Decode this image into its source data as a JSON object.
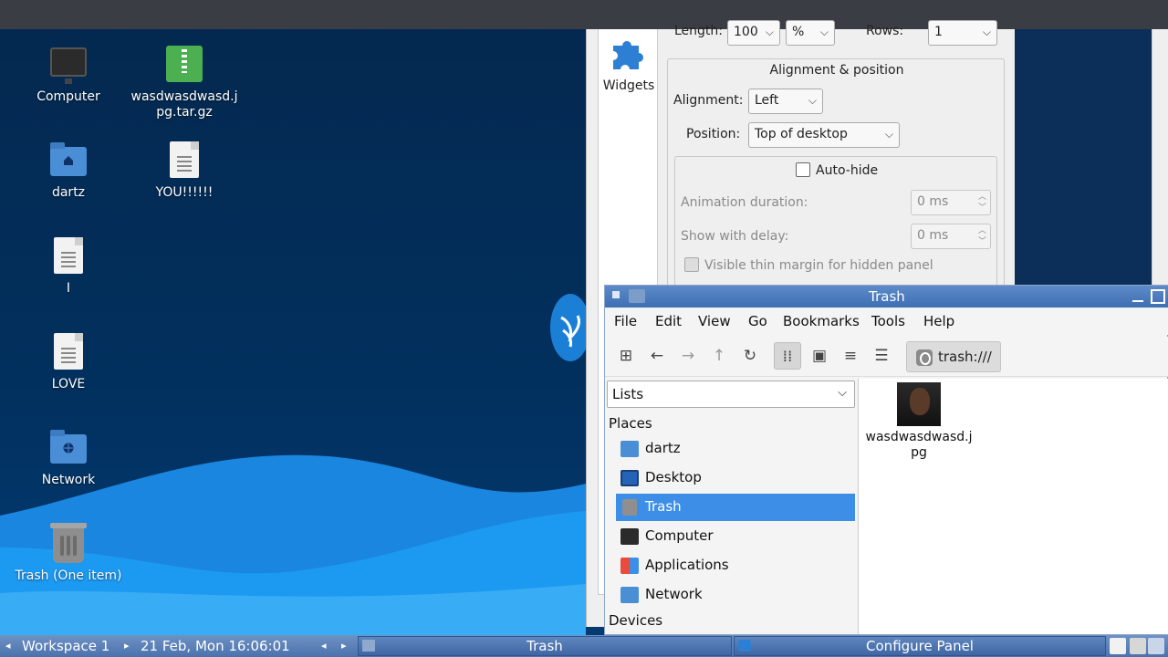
{
  "desktop": {
    "icons": [
      {
        "label": "Computer",
        "icon": "computer-icon"
      },
      {
        "label": "wasdwasdwasd.jpg.tar.gz",
        "icon": "archive-icon"
      },
      {
        "label": "dartz",
        "icon": "home-folder-icon"
      },
      {
        "label": "YOU!!!!!!",
        "icon": "text-file-icon"
      },
      {
        "label": "I",
        "icon": "text-file-icon"
      },
      {
        "label": "LOVE",
        "icon": "text-file-icon"
      },
      {
        "label": "Network",
        "icon": "network-folder-icon"
      },
      {
        "label": "Trash (One item)",
        "icon": "trash-icon"
      }
    ]
  },
  "config_panel": {
    "widgets_label": "Widgets",
    "length_label": "Length:",
    "length_value": "100",
    "length_unit": "%",
    "rows_label": "Rows:",
    "rows_value": "1",
    "alignment_group_title": "Alignment & position",
    "alignment_label": "Alignment:",
    "alignment_value": "Left",
    "position_label": "Position:",
    "position_value": "Top of desktop",
    "autohide_label": "Auto-hide",
    "animation_label": "Animation duration:",
    "animation_value": "0 ms",
    "delay_label": "Show with delay:",
    "delay_value": "0 ms",
    "thin_margin_label": "Visible thin margin for hidden panel"
  },
  "file_manager": {
    "title": "Trash",
    "menu": [
      "File",
      "Edit",
      "View",
      "Go",
      "Bookmarks",
      "Tools",
      "Help"
    ],
    "address": "trash:///",
    "side_mode": "Lists",
    "places_header": "Places",
    "places": [
      {
        "label": "dartz",
        "icon": "home-folder-icon"
      },
      {
        "label": "Desktop",
        "icon": "desktop-icon"
      },
      {
        "label": "Trash",
        "icon": "trash-icon"
      },
      {
        "label": "Computer",
        "icon": "computer-icon"
      },
      {
        "label": "Applications",
        "icon": "applications-icon"
      },
      {
        "label": "Network",
        "icon": "network-folder-icon"
      }
    ],
    "devices_header": "Devices",
    "files": [
      {
        "name": "wasdwasdwasd.jpg"
      }
    ]
  },
  "taskbar": {
    "workspace": "Workspace 1",
    "clock": "21 Feb, Mon 16:06:01",
    "tasks": [
      {
        "label": "Trash"
      },
      {
        "label": "Configure Panel"
      }
    ]
  },
  "colors": {
    "desktop_bg": "#022a57",
    "wave_light": "#1e9bf0",
    "selection": "#3d8ee6",
    "titlebar": "#4a7ab9",
    "taskbar": "#5a80b8"
  }
}
